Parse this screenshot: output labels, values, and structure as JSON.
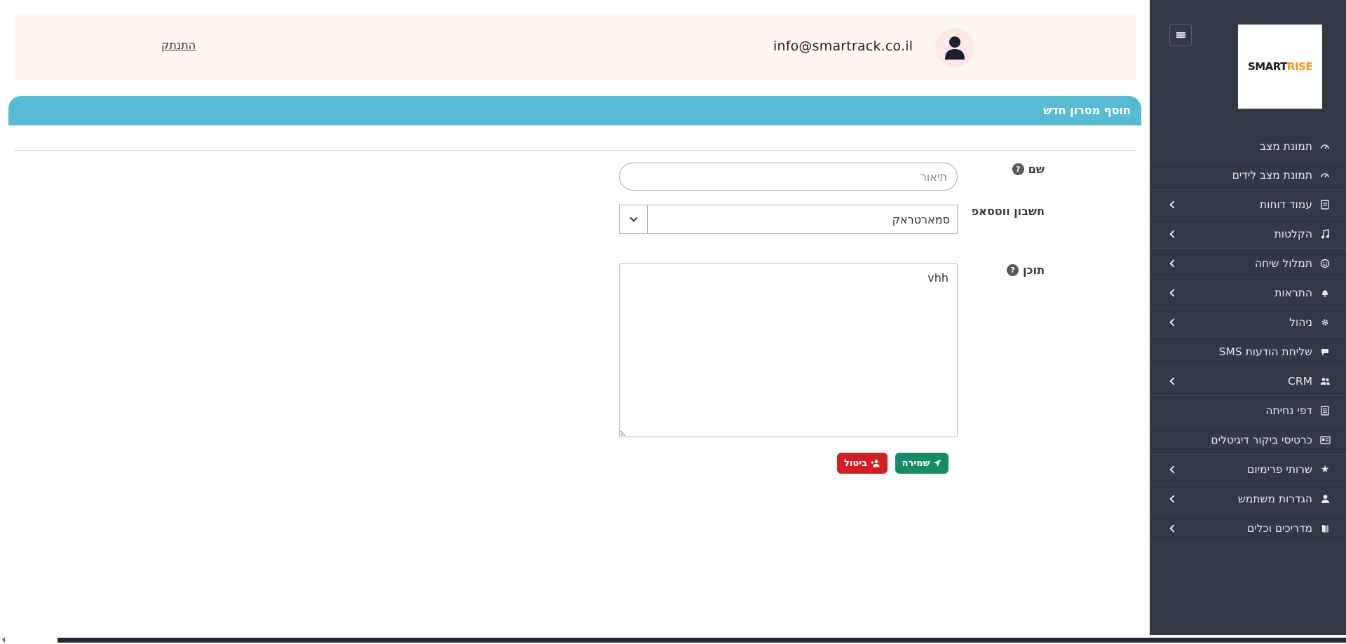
{
  "topbar": {
    "logout_label": "התנתק",
    "user_email": "info@smartrack.co.il"
  },
  "logo": {
    "text_main": "SMART",
    "text_accent": "RISE"
  },
  "sidebar": {
    "items": [
      {
        "label": "תמונת מצב",
        "icon": "gauge-icon",
        "has_submenu": false
      },
      {
        "label": "תמונת מצב לידים",
        "icon": "gauge-icon",
        "has_submenu": false
      },
      {
        "label": "עמוד דוחות",
        "icon": "report-icon",
        "has_submenu": true
      },
      {
        "label": "הקלטות",
        "icon": "music-note-icon",
        "has_submenu": true
      },
      {
        "label": "תמלול שיחה",
        "icon": "smile-icon",
        "has_submenu": true
      },
      {
        "label": "התראות",
        "icon": "bell-icon",
        "has_submenu": true
      },
      {
        "label": "ניהול",
        "icon": "gear-icon",
        "has_submenu": true
      },
      {
        "label": "שליחת הודעות SMS",
        "icon": "message-icon",
        "has_submenu": false
      },
      {
        "label": "CRM",
        "icon": "users-icon",
        "has_submenu": true
      },
      {
        "label": "דפי נחיתה",
        "icon": "page-icon",
        "has_submenu": false
      },
      {
        "label": "כרטיסי ביקור דיגיטלים",
        "icon": "card-icon",
        "has_submenu": false
      },
      {
        "label": "שרותי פרימיום",
        "icon": "star-icon",
        "has_submenu": true
      },
      {
        "label": "הגדרות משתמש",
        "icon": "user-icon",
        "has_submenu": true
      },
      {
        "label": "מדריכים וכלים",
        "icon": "book-icon",
        "has_submenu": true
      }
    ]
  },
  "page": {
    "title": "חוסף מסרון חדש"
  },
  "form": {
    "name": {
      "label": "שם",
      "placeholder": "תיאור",
      "value": ""
    },
    "whatsapp_account": {
      "label": "חשבון ווטסאפ",
      "selected": "סמארטראק"
    },
    "content": {
      "label": "תוכן",
      "value": "vhh"
    },
    "save_label": "שמירה",
    "cancel_label": "ביטול"
  },
  "colors": {
    "sidebar_bg": "#323844",
    "header_bar": "#57bbd4",
    "save_button": "#198a68",
    "cancel_button": "#d01f26",
    "topbar_bg": "#fff7f2"
  }
}
